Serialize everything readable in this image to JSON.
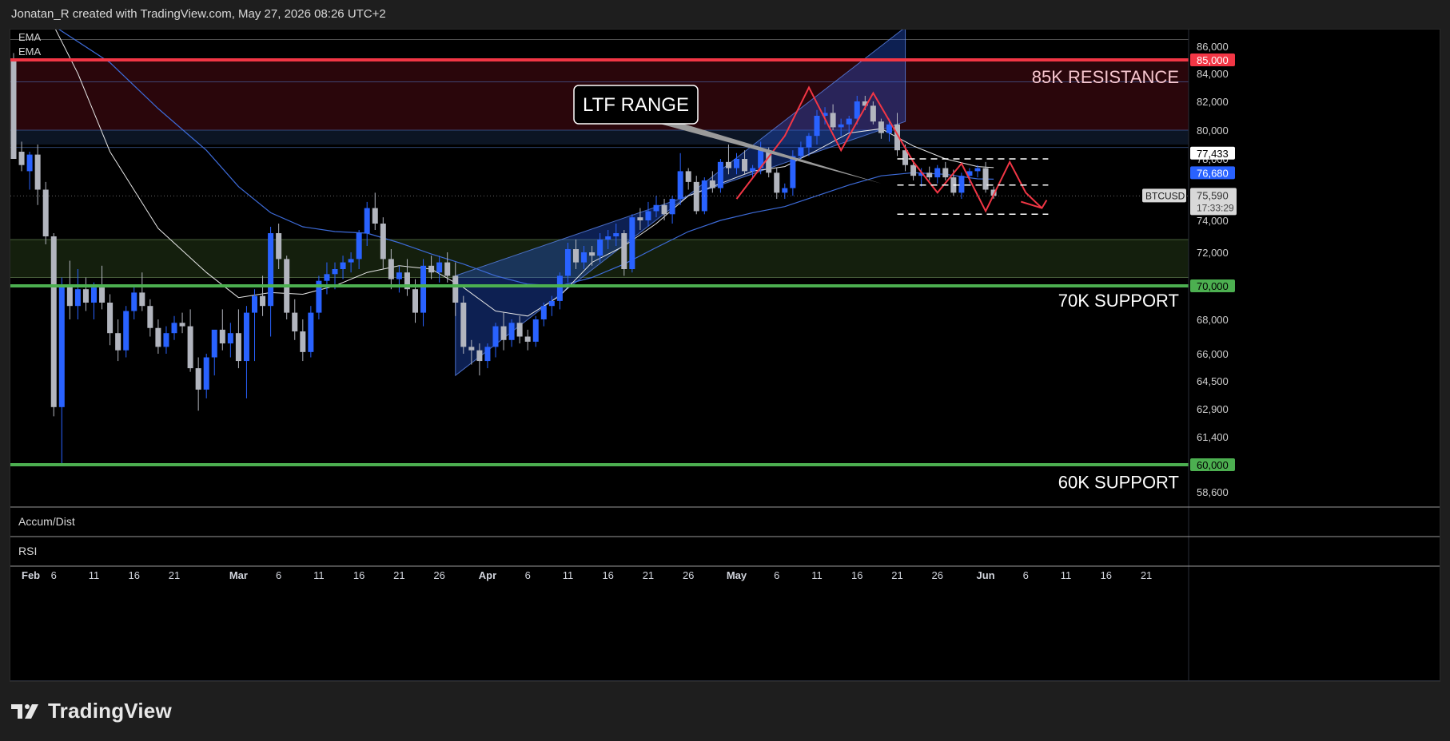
{
  "header": {
    "attribution": "Jonatan_R created with TradingView.com, May 27, 2026 08:26 UTC+2"
  },
  "footer": {
    "brand": "TradingView"
  },
  "indicators": {
    "ema_1": "EMA",
    "ema_2": "EMA",
    "accum_dist": "Accum/Dist",
    "rsi": "RSI"
  },
  "colors": {
    "bull": "#2962ff",
    "bear": "#b2b5be",
    "resistance": "#f23645",
    "support": "#4caf50",
    "channel": "#2962ff"
  },
  "chart_data": {
    "type": "candlestick",
    "symbol": "BTCUSD",
    "x_ticks": [
      "Feb",
      "6",
      "11",
      "16",
      "21",
      "Mar",
      "6",
      "11",
      "16",
      "21",
      "26",
      "Apr",
      "6",
      "11",
      "16",
      "21",
      "26",
      "May",
      "6",
      "11",
      "16",
      "21",
      "26",
      "Jun",
      "6",
      "11",
      "16",
      "21"
    ],
    "y_ticks": [
      "86,000",
      "84,000",
      "82,000",
      "80,000",
      "78,000",
      "74,000",
      "72,000",
      "70,000",
      "68,000",
      "66,000",
      "64,500",
      "62,900",
      "61,400",
      "58,600"
    ],
    "ylim": [
      57500,
      87500
    ],
    "price_tags": {
      "r85": "85,000",
      "s70": "70,000",
      "s60": "60,000",
      "ema_a": "77,433",
      "ema_b": "76,680",
      "last": "75,590",
      "countdown": "17:33:29"
    },
    "annotations": {
      "resistance": "85K RESISTANCE",
      "support_70": "70K SUPPORT",
      "support_60": "60K SUPPORT",
      "callout": "LTF RANGE"
    },
    "levels": [
      85000,
      70000,
      60000
    ],
    "resistance_zone": [
      80000,
      85000
    ],
    "support_zone": [
      70500,
      72800
    ],
    "candles": [
      {
        "day": 0,
        "o": 85000,
        "h": 85500,
        "l": 78500,
        "c": 78000
      },
      {
        "day": 1,
        "o": 78500,
        "h": 79200,
        "l": 77200,
        "c": 77600
      },
      {
        "day": 2,
        "o": 77200,
        "h": 78500,
        "l": 76000,
        "c": 78300
      },
      {
        "day": 3,
        "o": 78300,
        "h": 79000,
        "l": 75000,
        "c": 76000
      },
      {
        "day": 4,
        "o": 76000,
        "h": 76500,
        "l": 72500,
        "c": 73000
      },
      {
        "day": 5,
        "o": 73000,
        "h": 73200,
        "l": 62500,
        "c": 63000
      },
      {
        "day": 6,
        "o": 63000,
        "h": 70500,
        "l": 60000,
        "c": 70000
      },
      {
        "day": 7,
        "o": 70000,
        "h": 71500,
        "l": 68000,
        "c": 68800
      },
      {
        "day": 8,
        "o": 68800,
        "h": 71000,
        "l": 68000,
        "c": 69800
      },
      {
        "day": 9,
        "o": 69800,
        "h": 70500,
        "l": 68500,
        "c": 69000
      },
      {
        "day": 10,
        "o": 69000,
        "h": 70200,
        "l": 68000,
        "c": 69900
      },
      {
        "day": 11,
        "o": 69900,
        "h": 71200,
        "l": 68600,
        "c": 69000
      },
      {
        "day": 12,
        "o": 69000,
        "h": 69500,
        "l": 66500,
        "c": 67200
      },
      {
        "day": 13,
        "o": 67200,
        "h": 68000,
        "l": 65600,
        "c": 66200
      },
      {
        "day": 14,
        "o": 66200,
        "h": 68800,
        "l": 65800,
        "c": 68500
      },
      {
        "day": 15,
        "o": 68500,
        "h": 70000,
        "l": 68000,
        "c": 69600
      },
      {
        "day": 16,
        "o": 69600,
        "h": 70800,
        "l": 68500,
        "c": 68800
      },
      {
        "day": 17,
        "o": 68800,
        "h": 69200,
        "l": 67000,
        "c": 67500
      },
      {
        "day": 18,
        "o": 67500,
        "h": 68000,
        "l": 66000,
        "c": 66400
      },
      {
        "day": 19,
        "o": 66400,
        "h": 67600,
        "l": 66000,
        "c": 67200
      },
      {
        "day": 20,
        "o": 67200,
        "h": 68200,
        "l": 66800,
        "c": 67800
      },
      {
        "day": 21,
        "o": 67800,
        "h": 68400,
        "l": 67200,
        "c": 67600
      },
      {
        "day": 22,
        "o": 67600,
        "h": 68600,
        "l": 65000,
        "c": 65200
      },
      {
        "day": 23,
        "o": 65200,
        "h": 65800,
        "l": 62800,
        "c": 64000
      },
      {
        "day": 24,
        "o": 64000,
        "h": 66000,
        "l": 63500,
        "c": 65800
      },
      {
        "day": 25,
        "o": 65800,
        "h": 67000,
        "l": 64800,
        "c": 67400
      },
      {
        "day": 26,
        "o": 67400,
        "h": 68600,
        "l": 66200,
        "c": 66600
      },
      {
        "day": 27,
        "o": 66600,
        "h": 67800,
        "l": 65800,
        "c": 67200
      },
      {
        "day": 28,
        "o": 67200,
        "h": 68600,
        "l": 65200,
        "c": 65600
      },
      {
        "day": 29,
        "o": 65600,
        "h": 68800,
        "l": 63500,
        "c": 68400
      },
      {
        "day": 30,
        "o": 68400,
        "h": 69800,
        "l": 65600,
        "c": 69400
      },
      {
        "day": 31,
        "o": 69400,
        "h": 70600,
        "l": 68200,
        "c": 68800
      },
      {
        "day": 32,
        "o": 68800,
        "h": 73600,
        "l": 67000,
        "c": 73200
      },
      {
        "day": 33,
        "o": 73200,
        "h": 73800,
        "l": 71000,
        "c": 71600
      },
      {
        "day": 34,
        "o": 71600,
        "h": 71800,
        "l": 68000,
        "c": 68400
      },
      {
        "day": 35,
        "o": 68400,
        "h": 69200,
        "l": 66800,
        "c": 67300
      },
      {
        "day": 36,
        "o": 67300,
        "h": 68000,
        "l": 65600,
        "c": 66100
      },
      {
        "day": 37,
        "o": 66100,
        "h": 68800,
        "l": 65800,
        "c": 68400
      },
      {
        "day": 38,
        "o": 68400,
        "h": 70600,
        "l": 68000,
        "c": 70300
      },
      {
        "day": 39,
        "o": 70300,
        "h": 71400,
        "l": 69500,
        "c": 70700
      },
      {
        "day": 40,
        "o": 70700,
        "h": 71400,
        "l": 69800,
        "c": 71000
      },
      {
        "day": 41,
        "o": 71000,
        "h": 71800,
        "l": 70400,
        "c": 71400
      },
      {
        "day": 42,
        "o": 71400,
        "h": 72000,
        "l": 70800,
        "c": 71600
      },
      {
        "day": 43,
        "o": 71600,
        "h": 73400,
        "l": 71000,
        "c": 73200
      },
      {
        "day": 44,
        "o": 73200,
        "h": 75200,
        "l": 72400,
        "c": 74800
      },
      {
        "day": 45,
        "o": 74800,
        "h": 75800,
        "l": 73400,
        "c": 73800
      },
      {
        "day": 46,
        "o": 73800,
        "h": 74200,
        "l": 71000,
        "c": 71600
      },
      {
        "day": 47,
        "o": 71600,
        "h": 72200,
        "l": 69800,
        "c": 70400
      },
      {
        "day": 48,
        "o": 70400,
        "h": 71200,
        "l": 69600,
        "c": 70800
      },
      {
        "day": 49,
        "o": 70800,
        "h": 71600,
        "l": 69400,
        "c": 69800
      },
      {
        "day": 50,
        "o": 69800,
        "h": 70400,
        "l": 67800,
        "c": 68400
      },
      {
        "day": 51,
        "o": 68400,
        "h": 71600,
        "l": 67600,
        "c": 71200
      },
      {
        "day": 52,
        "o": 71200,
        "h": 71800,
        "l": 70400,
        "c": 70800
      },
      {
        "day": 53,
        "o": 70800,
        "h": 71800,
        "l": 70200,
        "c": 71400
      },
      {
        "day": 54,
        "o": 71400,
        "h": 72000,
        "l": 70200,
        "c": 70600
      },
      {
        "day": 55,
        "o": 70600,
        "h": 71400,
        "l": 68200,
        "c": 69000
      },
      {
        "day": 56,
        "o": 69000,
        "h": 69400,
        "l": 66000,
        "c": 66400
      },
      {
        "day": 57,
        "o": 66400,
        "h": 66800,
        "l": 65400,
        "c": 66200
      },
      {
        "day": 58,
        "o": 66200,
        "h": 66600,
        "l": 64800,
        "c": 65600
      },
      {
        "day": 59,
        "o": 65600,
        "h": 66600,
        "l": 65200,
        "c": 66400
      },
      {
        "day": 60,
        "o": 66400,
        "h": 67800,
        "l": 65800,
        "c": 67600
      },
      {
        "day": 61,
        "o": 67600,
        "h": 68400,
        "l": 66200,
        "c": 66800
      },
      {
        "day": 62,
        "o": 66800,
        "h": 68000,
        "l": 66400,
        "c": 67800
      },
      {
        "day": 63,
        "o": 67800,
        "h": 68200,
        "l": 66600,
        "c": 67000
      },
      {
        "day": 64,
        "o": 67000,
        "h": 67400,
        "l": 66200,
        "c": 66700
      },
      {
        "day": 65,
        "o": 66700,
        "h": 68200,
        "l": 66400,
        "c": 68000
      },
      {
        "day": 66,
        "o": 68000,
        "h": 69000,
        "l": 67600,
        "c": 68800
      },
      {
        "day": 67,
        "o": 68800,
        "h": 69400,
        "l": 68200,
        "c": 69100
      },
      {
        "day": 68,
        "o": 69100,
        "h": 70800,
        "l": 68600,
        "c": 70600
      },
      {
        "day": 69,
        "o": 70600,
        "h": 72600,
        "l": 70200,
        "c": 72200
      },
      {
        "day": 70,
        "o": 72200,
        "h": 72800,
        "l": 71000,
        "c": 71400
      },
      {
        "day": 71,
        "o": 71400,
        "h": 72400,
        "l": 71000,
        "c": 72000
      },
      {
        "day": 72,
        "o": 72000,
        "h": 72400,
        "l": 71200,
        "c": 71800
      },
      {
        "day": 73,
        "o": 71800,
        "h": 73200,
        "l": 71400,
        "c": 72800
      },
      {
        "day": 74,
        "o": 72800,
        "h": 73400,
        "l": 72200,
        "c": 73000
      },
      {
        "day": 75,
        "o": 73000,
        "h": 73800,
        "l": 72400,
        "c": 73200
      },
      {
        "day": 76,
        "o": 73200,
        "h": 73400,
        "l": 70600,
        "c": 71000
      },
      {
        "day": 77,
        "o": 71000,
        "h": 74400,
        "l": 70800,
        "c": 74200
      },
      {
        "day": 78,
        "o": 74200,
        "h": 74800,
        "l": 73400,
        "c": 74000
      },
      {
        "day": 79,
        "o": 74000,
        "h": 75200,
        "l": 73600,
        "c": 74600
      },
      {
        "day": 80,
        "o": 74600,
        "h": 75600,
        "l": 74200,
        "c": 75000
      },
      {
        "day": 81,
        "o": 75000,
        "h": 75400,
        "l": 74000,
        "c": 74400
      },
      {
        "day": 82,
        "o": 74400,
        "h": 75600,
        "l": 73800,
        "c": 75400
      },
      {
        "day": 83,
        "o": 75400,
        "h": 78400,
        "l": 75000,
        "c": 77200
      },
      {
        "day": 84,
        "o": 77200,
        "h": 77400,
        "l": 76000,
        "c": 76500
      },
      {
        "day": 85,
        "o": 76500,
        "h": 76900,
        "l": 74400,
        "c": 74600
      },
      {
        "day": 86,
        "o": 74600,
        "h": 76800,
        "l": 74400,
        "c": 76600
      },
      {
        "day": 87,
        "o": 76600,
        "h": 77200,
        "l": 75800,
        "c": 76100
      },
      {
        "day": 88,
        "o": 76100,
        "h": 78000,
        "l": 75800,
        "c": 77800
      },
      {
        "day": 89,
        "o": 77800,
        "h": 79000,
        "l": 77000,
        "c": 77400
      },
      {
        "day": 90,
        "o": 77400,
        "h": 78400,
        "l": 77000,
        "c": 78000
      },
      {
        "day": 91,
        "o": 78000,
        "h": 78600,
        "l": 77000,
        "c": 77200
      },
      {
        "day": 92,
        "o": 77200,
        "h": 77600,
        "l": 76800,
        "c": 77400
      },
      {
        "day": 93,
        "o": 77400,
        "h": 79200,
        "l": 77000,
        "c": 78600
      },
      {
        "day": 94,
        "o": 78600,
        "h": 78800,
        "l": 76800,
        "c": 77100
      },
      {
        "day": 95,
        "o": 77100,
        "h": 77400,
        "l": 75400,
        "c": 75800
      },
      {
        "day": 96,
        "o": 75800,
        "h": 76400,
        "l": 75400,
        "c": 76100
      },
      {
        "day": 97,
        "o": 76100,
        "h": 78600,
        "l": 75600,
        "c": 78200
      },
      {
        "day": 98,
        "o": 78200,
        "h": 79200,
        "l": 78000,
        "c": 78800
      },
      {
        "day": 99,
        "o": 78800,
        "h": 79800,
        "l": 78200,
        "c": 79600
      },
      {
        "day": 100,
        "o": 79600,
        "h": 81400,
        "l": 79000,
        "c": 81000
      },
      {
        "day": 101,
        "o": 81000,
        "h": 81600,
        "l": 80400,
        "c": 81200
      },
      {
        "day": 102,
        "o": 81200,
        "h": 81800,
        "l": 80000,
        "c": 80200
      },
      {
        "day": 103,
        "o": 80200,
        "h": 80800,
        "l": 79600,
        "c": 80400
      },
      {
        "day": 104,
        "o": 80400,
        "h": 81000,
        "l": 79800,
        "c": 80800
      },
      {
        "day": 105,
        "o": 80800,
        "h": 82400,
        "l": 80400,
        "c": 82000
      },
      {
        "day": 106,
        "o": 82000,
        "h": 82400,
        "l": 81400,
        "c": 81700
      },
      {
        "day": 107,
        "o": 81700,
        "h": 82000,
        "l": 80400,
        "c": 80600
      },
      {
        "day": 108,
        "o": 80600,
        "h": 80800,
        "l": 79400,
        "c": 79800
      },
      {
        "day": 109,
        "o": 79800,
        "h": 80800,
        "l": 79200,
        "c": 80400
      },
      {
        "day": 110,
        "o": 80400,
        "h": 81200,
        "l": 78200,
        "c": 78600
      },
      {
        "day": 111,
        "o": 78600,
        "h": 79000,
        "l": 77200,
        "c": 77600
      },
      {
        "day": 112,
        "o": 77600,
        "h": 77800,
        "l": 76600,
        "c": 76900
      },
      {
        "day": 113,
        "o": 76900,
        "h": 77400,
        "l": 76200,
        "c": 77100
      },
      {
        "day": 114,
        "o": 77100,
        "h": 77500,
        "l": 76600,
        "c": 76800
      },
      {
        "day": 115,
        "o": 76800,
        "h": 77600,
        "l": 76400,
        "c": 77400
      },
      {
        "day": 116,
        "o": 77400,
        "h": 77800,
        "l": 76600,
        "c": 76800
      },
      {
        "day": 117,
        "o": 76800,
        "h": 77300,
        "l": 75600,
        "c": 75800
      },
      {
        "day": 118,
        "o": 75800,
        "h": 77100,
        "l": 75400,
        "c": 76900
      },
      {
        "day": 119,
        "o": 76900,
        "h": 77400,
        "l": 76400,
        "c": 77200
      },
      {
        "day": 120,
        "o": 77200,
        "h": 77600,
        "l": 76800,
        "c": 77400
      },
      {
        "day": 121,
        "o": 77400,
        "h": 77800,
        "l": 75800,
        "c": 76000
      },
      {
        "day": 122,
        "o": 76000,
        "h": 76200,
        "l": 75400,
        "c": 75600
      }
    ]
  }
}
